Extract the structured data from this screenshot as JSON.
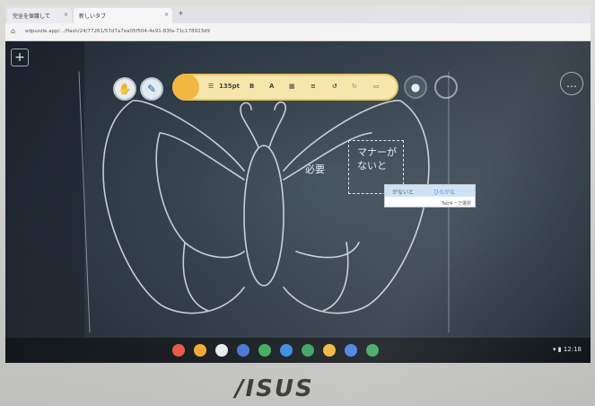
{
  "browser": {
    "tab1": "完全を保護して",
    "tab2": "新しいタブ",
    "url": "edpuzzle.app/.../flash/24/77261/57d7a7ea05f504-4e91-83fa-71c178923d9"
  },
  "toolbar": {
    "size": "135pt",
    "bold": "B",
    "font": "A"
  },
  "board": {
    "hitsuyo": "必要",
    "managa_line1": "マナーが",
    "managa_line2": "ないと"
  },
  "ime": {
    "candidate1": "がないと",
    "candidate2": "ひらがな",
    "hint": "Tabキーで選択"
  },
  "shelf": {
    "time": "12:18"
  },
  "laptop": {
    "logo": "/ISUS"
  },
  "colors": {
    "board": "#2a3743",
    "toolbar": "#f6e5a8",
    "accent": "#f2b53a"
  }
}
